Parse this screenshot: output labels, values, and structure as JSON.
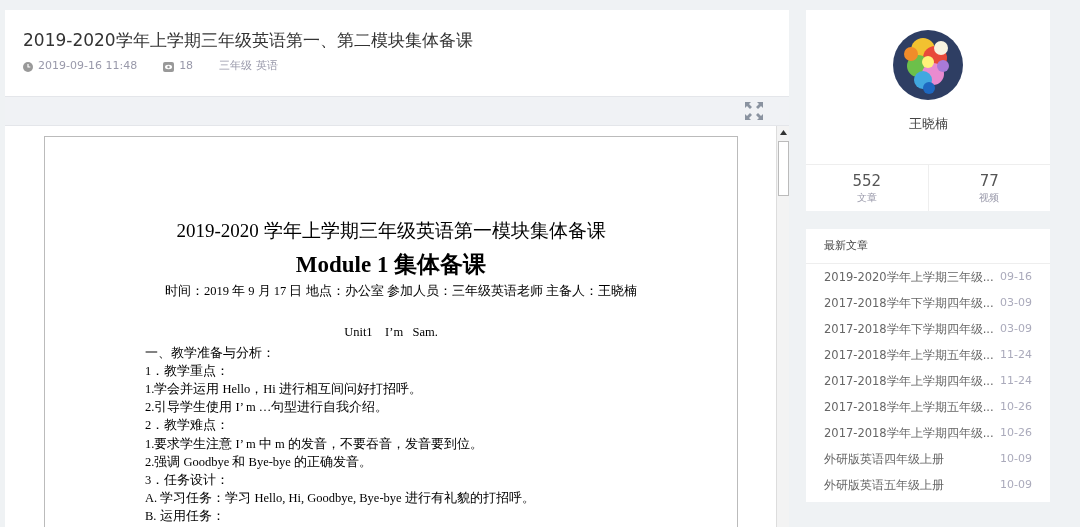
{
  "article": {
    "title": "2019-2020学年上学期三年级英语第一、第二模块集体备课",
    "time": "2019-09-16 11:48",
    "views": "18",
    "tags": "三年级 英语"
  },
  "document": {
    "title": "2019-2020 学年上学期三年级英语第一模块集体备课",
    "heading": "Module 1 集体备课",
    "info": "时间：2019 年 9 月 17 日   地点：办公室   参加人员：三年级英语老师   主备人：王晓楠",
    "unit": "Unit1    I’m   Sam.",
    "lines": [
      "一、教学准备与分析：",
      "1．教学重点：",
      "1.学会并运用 Hello，Hi 进行相互间问好打招呼。",
      "2.引导学生使用 I’ m …句型进行自我介绍。",
      "2．教学难点：",
      "1.要求学生注意 I’ m 中 m 的发音，不要吞音，发音要到位。",
      "2.强调 Goodbye 和 Bye-bye 的正确发音。",
      "3．任务设计：",
      "A. 学习任务：学习 Hello, Hi, Goodbye, Bye-bye 进行有礼貌的打招呼。",
      "B. 运用任务："
    ]
  },
  "profile": {
    "name": "王晓楠",
    "stats": [
      {
        "value": "552",
        "label": "文章"
      },
      {
        "value": "77",
        "label": "视频"
      }
    ]
  },
  "latest": {
    "title": "最新文章",
    "items": [
      {
        "title": "2019-2020学年上学期三年级...",
        "date": "09-16"
      },
      {
        "title": "2017-2018学年下学期四年级...",
        "date": "03-09"
      },
      {
        "title": "2017-2018学年下学期四年级...",
        "date": "03-09"
      },
      {
        "title": "2017-2018学年上学期五年级...",
        "date": "11-24"
      },
      {
        "title": "2017-2018学年上学期四年级...",
        "date": "11-24"
      },
      {
        "title": "2017-2018学年上学期五年级...",
        "date": "10-26"
      },
      {
        "title": "2017-2018学年上学期四年级...",
        "date": "10-26"
      },
      {
        "title": "外研版英语四年级上册",
        "date": "10-09"
      },
      {
        "title": "外研版英语五年级上册",
        "date": "10-09"
      }
    ]
  }
}
